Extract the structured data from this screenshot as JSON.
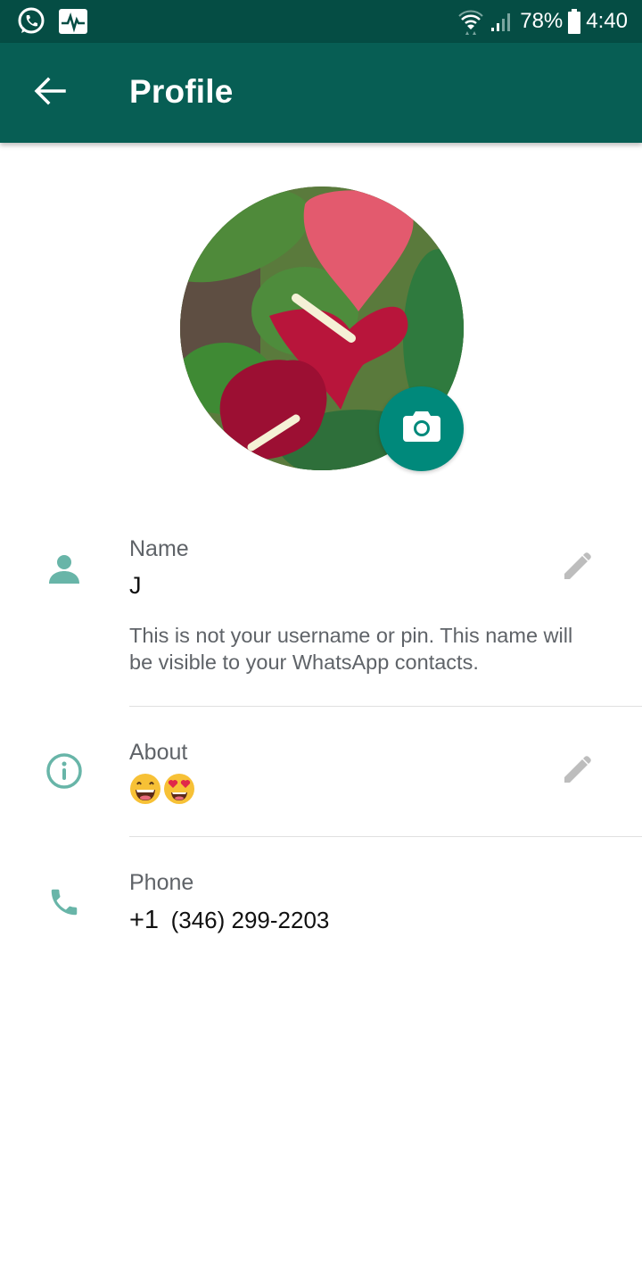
{
  "status_bar": {
    "left_icons": [
      "whatsapp-icon",
      "activity-monitor-icon"
    ],
    "wifi": "wifi-icon",
    "signal": "signal-icon",
    "battery_percent": "78%",
    "battery_level": 0.78,
    "time": "4:40"
  },
  "app_bar": {
    "back_icon": "arrow-left-icon",
    "title": "Profile"
  },
  "profile_photo": {
    "description": "Red anthurium flowers with green leaves",
    "camera_icon": "camera-icon"
  },
  "rows": {
    "name": {
      "icon": "person-icon",
      "label": "Name",
      "value": "J",
      "hint": "This is not your username or pin. This name will be visible to your WhatsApp contacts.",
      "edit_icon": "pencil-icon"
    },
    "about": {
      "icon": "info-icon",
      "label": "About",
      "value": "😄😍",
      "emojis": [
        "grinning-face-with-smiling-eyes",
        "smiling-face-with-heart-eyes"
      ],
      "edit_icon": "pencil-icon"
    },
    "phone": {
      "icon": "phone-icon",
      "label": "Phone",
      "country_code": "+1",
      "number": "(346) 299-2203"
    }
  },
  "colors": {
    "status_bar": "#054d44",
    "app_bar": "#075e54",
    "accent": "#00897b",
    "row_icon": "#68b5a8",
    "edit_icon": "#bdbdbd",
    "secondary_text": "#5f6368"
  }
}
